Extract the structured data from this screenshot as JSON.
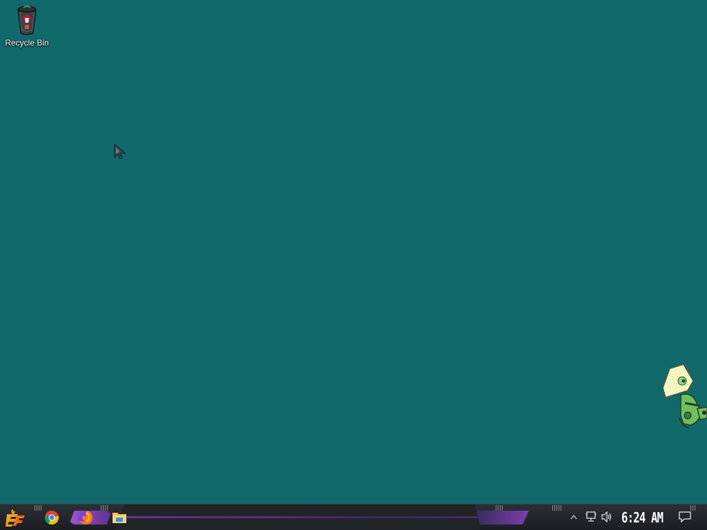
{
  "desktop": {
    "background_color": "#11696b",
    "icons": [
      {
        "label": "Recycle Bin",
        "icon": "recycle-bin-icon"
      }
    ]
  },
  "taskbar": {
    "start": {
      "icon": "start-logo-icon"
    },
    "pinned": [
      {
        "name": "Google Chrome",
        "icon": "chrome-icon"
      },
      {
        "name": "Firefox",
        "icon": "firefox-icon"
      },
      {
        "name": "File Explorer",
        "icon": "file-explorer-icon"
      }
    ],
    "tray": {
      "overflow_icon": "chevron-up-icon",
      "network_icon": "network-icon",
      "volume_icon": "volume-icon",
      "clock": "6:24 AM",
      "notifications_icon": "action-center-icon"
    },
    "accent_color": "#7a3fb0"
  }
}
